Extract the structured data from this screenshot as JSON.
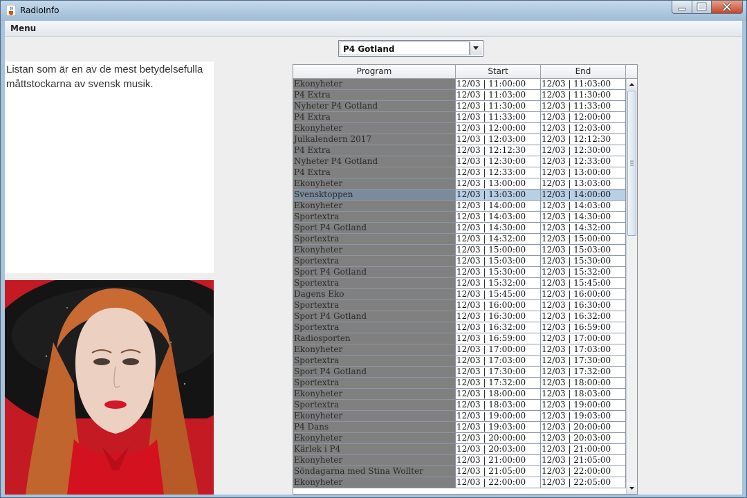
{
  "window": {
    "title": "RadioInfo"
  },
  "menubar": {
    "menu_label": "Menu"
  },
  "channel_select": {
    "selected": "P4 Gotland"
  },
  "description": {
    "text": "Listan som är en av de mest betydelsefulla måttstockarna av svensk musik."
  },
  "table": {
    "columns": [
      "Program",
      "Start",
      "End"
    ],
    "rows": [
      {
        "program": "Ekonyheter",
        "start": "12/03 | 11:00:00",
        "end": "12/03 | 11:03:00"
      },
      {
        "program": "P4 Extra",
        "start": "12/03 | 11:03:00",
        "end": "12/03 | 11:30:00"
      },
      {
        "program": "Nyheter P4 Gotland",
        "start": "12/03 | 11:30:00",
        "end": "12/03 | 11:33:00"
      },
      {
        "program": "P4 Extra",
        "start": "12/03 | 11:33:00",
        "end": "12/03 | 12:00:00"
      },
      {
        "program": "Ekonyheter",
        "start": "12/03 | 12:00:00",
        "end": "12/03 | 12:03:00"
      },
      {
        "program": "Julkalendern 2017",
        "start": "12/03 | 12:03:00",
        "end": "12/03 | 12:12:30"
      },
      {
        "program": "P4 Extra",
        "start": "12/03 | 12:12:30",
        "end": "12/03 | 12:30:00"
      },
      {
        "program": "Nyheter P4 Gotland",
        "start": "12/03 | 12:30:00",
        "end": "12/03 | 12:33:00"
      },
      {
        "program": "P4 Extra",
        "start": "12/03 | 12:33:00",
        "end": "12/03 | 13:00:00"
      },
      {
        "program": "Ekonyheter",
        "start": "12/03 | 13:00:00",
        "end": "12/03 | 13:03:00"
      },
      {
        "program": "Svensktoppen",
        "start": "12/03 | 13:03:00",
        "end": "12/03 | 14:00:00",
        "selected": true
      },
      {
        "program": "Ekonyheter",
        "start": "12/03 | 14:00:00",
        "end": "12/03 | 14:03:00"
      },
      {
        "program": "Sportextra",
        "start": "12/03 | 14:03:00",
        "end": "12/03 | 14:30:00"
      },
      {
        "program": "Sport P4 Gotland",
        "start": "12/03 | 14:30:00",
        "end": "12/03 | 14:32:00"
      },
      {
        "program": "Sportextra",
        "start": "12/03 | 14:32:00",
        "end": "12/03 | 15:00:00"
      },
      {
        "program": "Ekonyheter",
        "start": "12/03 | 15:00:00",
        "end": "12/03 | 15:03:00"
      },
      {
        "program": "Sportextra",
        "start": "12/03 | 15:03:00",
        "end": "12/03 | 15:30:00"
      },
      {
        "program": "Sport P4 Gotland",
        "start": "12/03 | 15:30:00",
        "end": "12/03 | 15:32:00"
      },
      {
        "program": "Sportextra",
        "start": "12/03 | 15:32:00",
        "end": "12/03 | 15:45:00"
      },
      {
        "program": "Dagens Eko",
        "start": "12/03 | 15:45:00",
        "end": "12/03 | 16:00:00"
      },
      {
        "program": "Sportextra",
        "start": "12/03 | 16:00:00",
        "end": "12/03 | 16:30:00"
      },
      {
        "program": "Sport P4 Gotland",
        "start": "12/03 | 16:30:00",
        "end": "12/03 | 16:32:00"
      },
      {
        "program": "Sportextra",
        "start": "12/03 | 16:32:00",
        "end": "12/03 | 16:59:00"
      },
      {
        "program": "Radiosporten",
        "start": "12/03 | 16:59:00",
        "end": "12/03 | 17:00:00"
      },
      {
        "program": "Ekonyheter",
        "start": "12/03 | 17:00:00",
        "end": "12/03 | 17:03:00"
      },
      {
        "program": "Sportextra",
        "start": "12/03 | 17:03:00",
        "end": "12/03 | 17:30:00"
      },
      {
        "program": "Sport P4 Gotland",
        "start": "12/03 | 17:30:00",
        "end": "12/03 | 17:32:00"
      },
      {
        "program": "Sportextra",
        "start": "12/03 | 17:32:00",
        "end": "12/03 | 18:00:00"
      },
      {
        "program": "Ekonyheter",
        "start": "12/03 | 18:00:00",
        "end": "12/03 | 18:03:00"
      },
      {
        "program": "Sportextra",
        "start": "12/03 | 18:03:00",
        "end": "12/03 | 19:00:00"
      },
      {
        "program": "Ekonyheter",
        "start": "12/03 | 19:00:00",
        "end": "12/03 | 19:03:00"
      },
      {
        "program": "P4 Dans",
        "start": "12/03 | 19:03:00",
        "end": "12/03 | 20:00:00"
      },
      {
        "program": "Ekonyheter",
        "start": "12/03 | 20:00:00",
        "end": "12/03 | 20:03:00"
      },
      {
        "program": "Kärlek i P4",
        "start": "12/03 | 20:03:00",
        "end": "12/03 | 21:00:00"
      },
      {
        "program": "Ekonyheter",
        "start": "12/03 | 21:00:00",
        "end": "12/03 | 21:05:00"
      },
      {
        "program": "Söndagarna med Stina Wollter",
        "start": "12/03 | 21:05:00",
        "end": "12/03 | 22:00:00"
      },
      {
        "program": "Ekonyheter",
        "start": "12/03 | 22:00:00",
        "end": "12/03 | 22:05:00"
      }
    ]
  },
  "icons": {
    "app": "java-cup-icon",
    "minimize": "minimize-icon",
    "maximize": "maximize-icon",
    "close": "close-icon",
    "dropdown": "chevron-down-icon",
    "scroll_up": "arrow-up-icon",
    "scroll_down": "arrow-down-icon"
  },
  "colors": {
    "program_cell_bg": "#808080",
    "selected_row": "#b8cfe5",
    "close_button": "#c8452a"
  }
}
